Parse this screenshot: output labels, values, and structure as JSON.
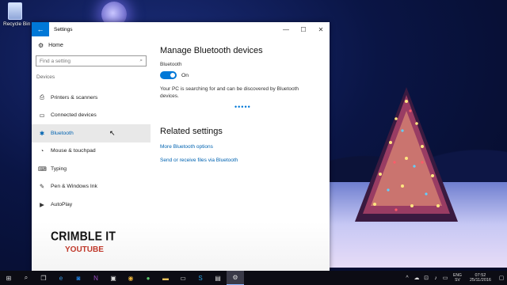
{
  "desktop": {
    "recycle_bin_label": "Recycle Bin"
  },
  "window": {
    "title": "Settings",
    "back_glyph": "←",
    "controls": {
      "minimize": "—",
      "maximize": "☐",
      "close": "✕"
    }
  },
  "nav": {
    "home_label": "Home",
    "search_placeholder": "Find a setting",
    "section_label": "Devices",
    "items": [
      {
        "label": "Printers & scanners",
        "icon": "printer-icon",
        "glyph": "⎙"
      },
      {
        "label": "Connected devices",
        "icon": "devices-icon",
        "glyph": "▭"
      },
      {
        "label": "Bluetooth",
        "icon": "bluetooth-icon",
        "glyph": "✱",
        "selected": true
      },
      {
        "label": "Mouse & touchpad",
        "icon": "mouse-icon",
        "glyph": "◔"
      },
      {
        "label": "Typing",
        "icon": "keyboard-icon",
        "glyph": "⌨"
      },
      {
        "label": "Pen & Windows Ink",
        "icon": "pen-icon",
        "glyph": "✎"
      },
      {
        "label": "AutoPlay",
        "icon": "autoplay-icon",
        "glyph": "▶"
      }
    ]
  },
  "main": {
    "heading": "Manage Bluetooth devices",
    "bluetooth_label": "Bluetooth",
    "toggle_state": "On",
    "toggle_on": true,
    "description": "Your PC is searching for and can be discovered by Bluetooth devices.",
    "progress_dots": "•••••",
    "related_heading": "Related settings",
    "links": [
      "More Bluetooth options",
      "Send or receive files via Bluetooth"
    ]
  },
  "watermark": {
    "line1": "CRIMBLE IT",
    "line2": "YOUTUBE"
  },
  "taskbar": {
    "language": "ENG",
    "region": "SV",
    "time": "07:52",
    "date": "25/11/2016"
  },
  "colors": {
    "accent": "#0078d7",
    "link": "#0063b1",
    "taskbar": "#0c0c14"
  }
}
